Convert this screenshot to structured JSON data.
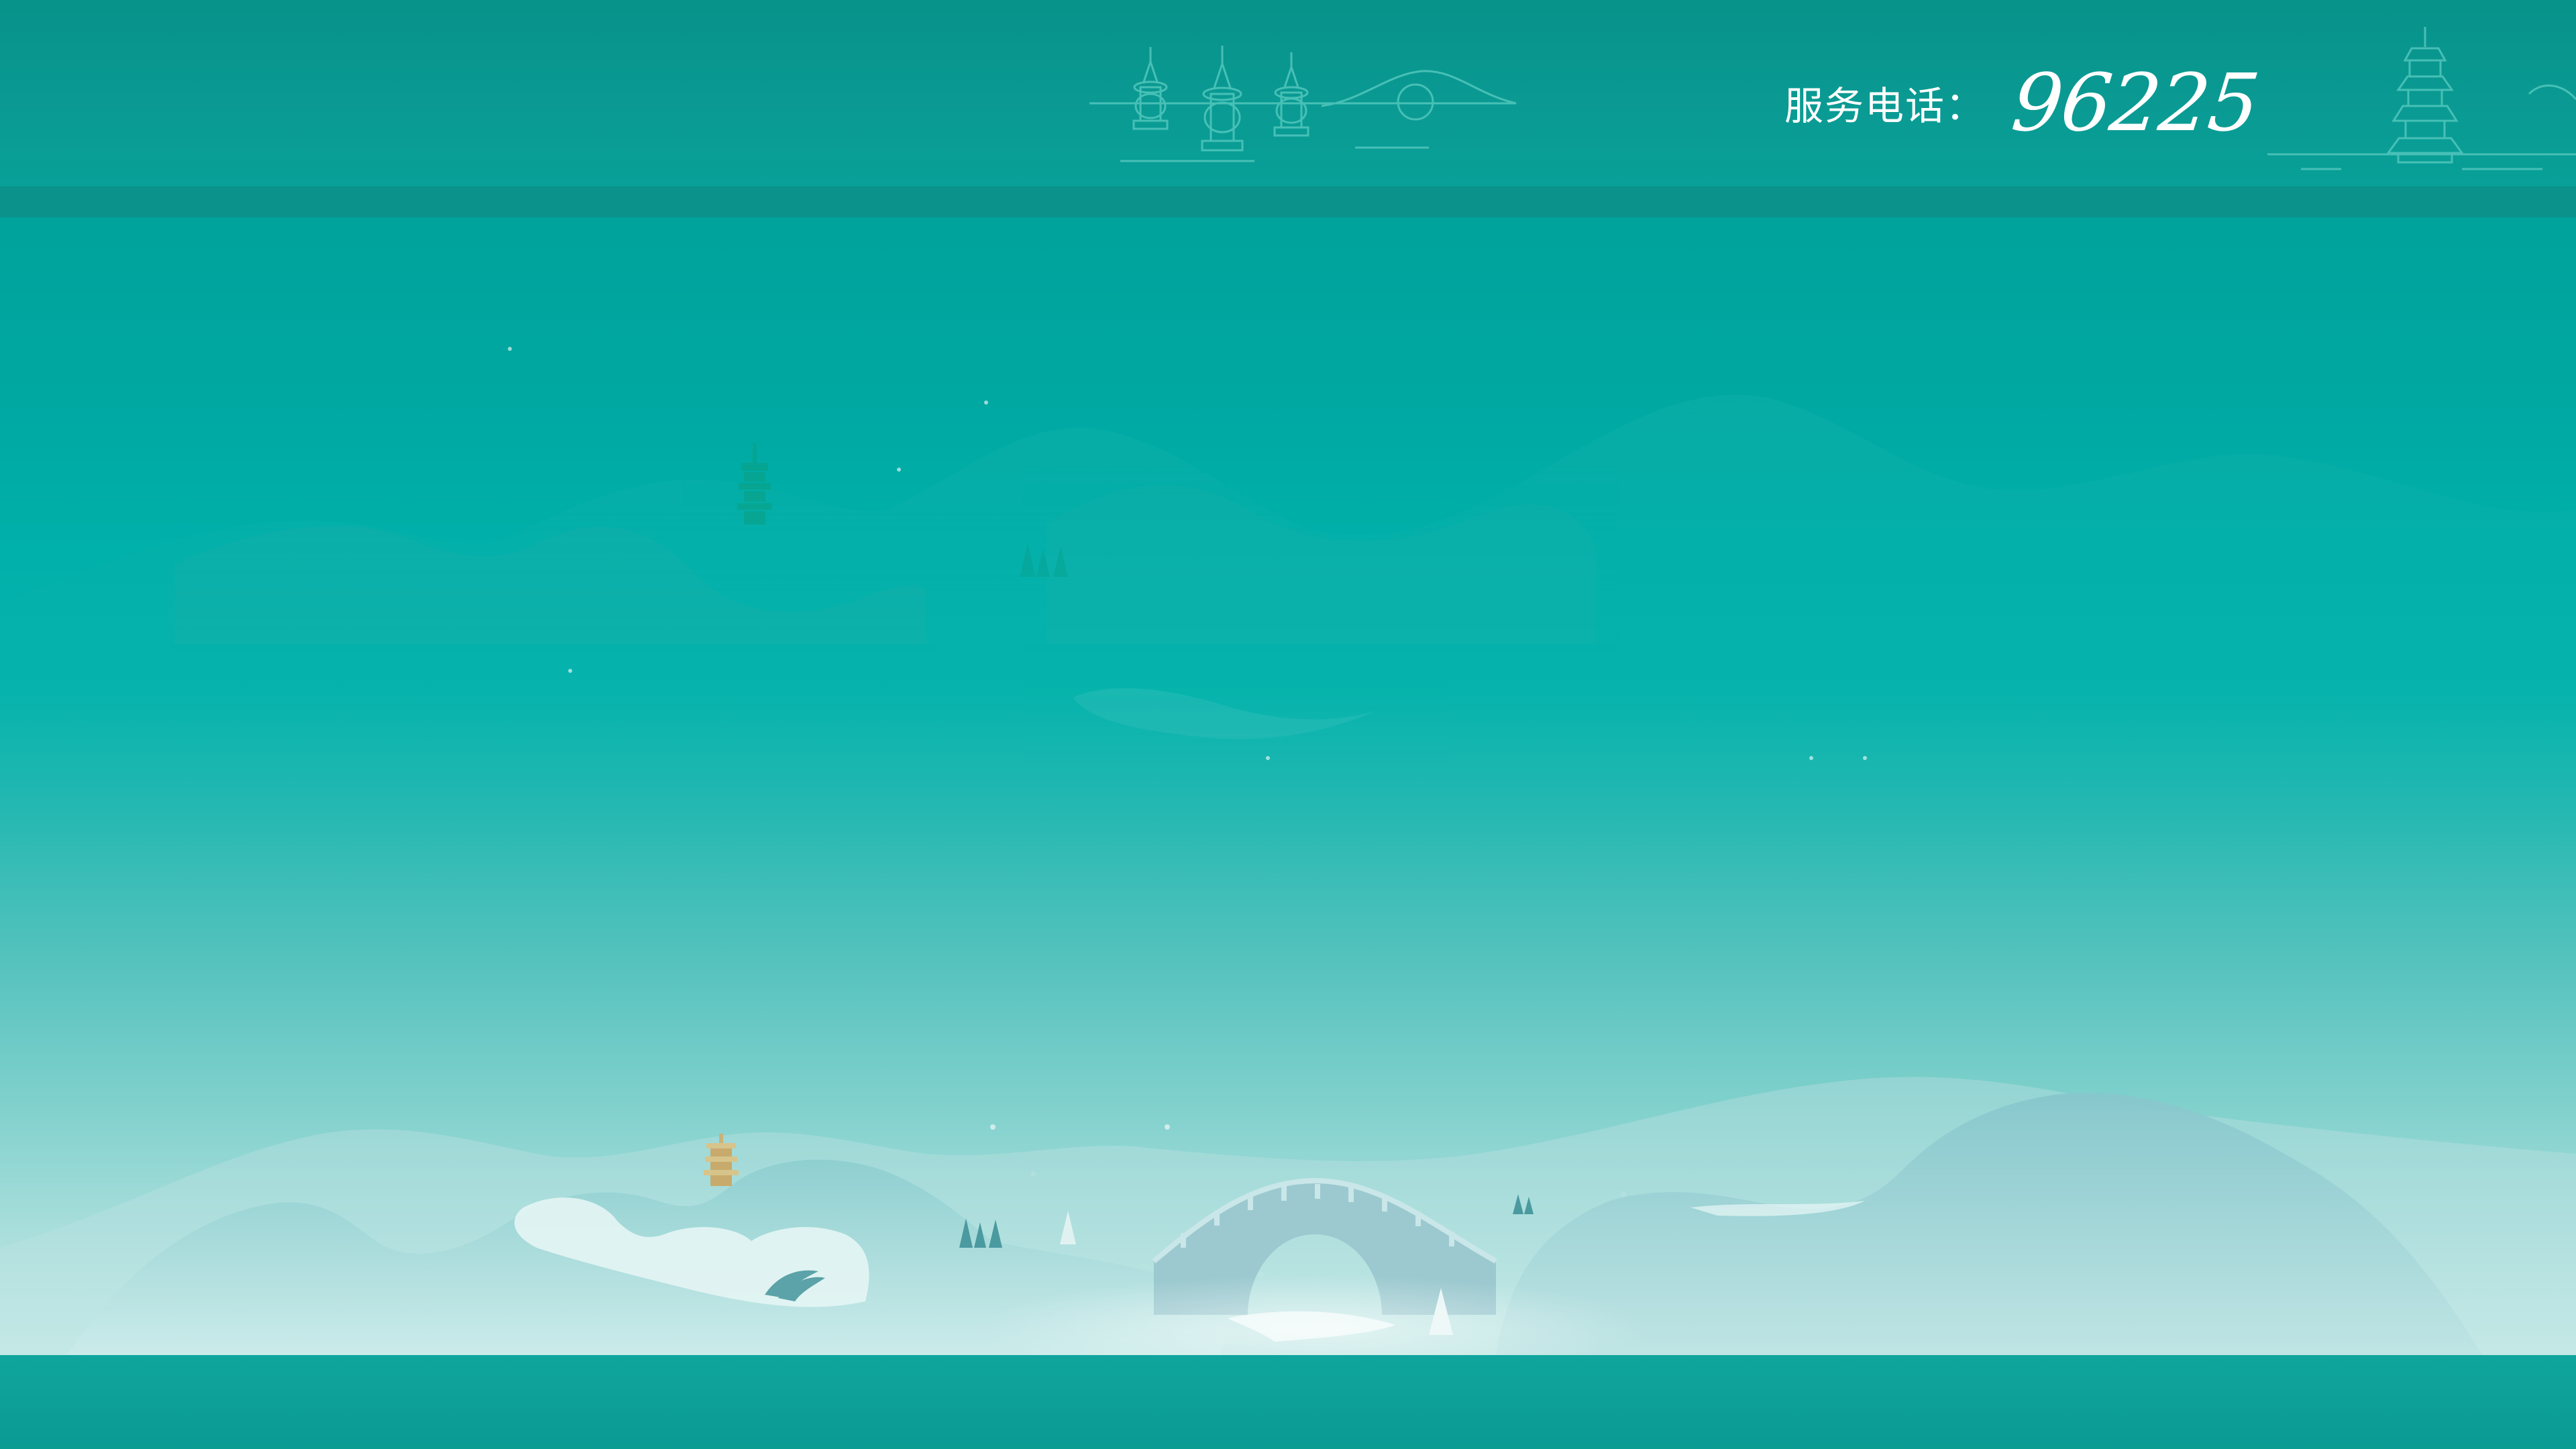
{
  "header": {
    "phone_label": "服务电话：",
    "phone_number": "96225"
  },
  "scene": {
    "landmark_left": "three-pools-pagoda-icon",
    "landmark_right": "leifeng-pagoda-icon",
    "bridge": "arch-bridge-icon"
  },
  "colors": {
    "header_top": "#07928a",
    "teal_mid": "#00b0aa",
    "mist_bottom": "#d4efec",
    "footer": "#0a9b93"
  }
}
